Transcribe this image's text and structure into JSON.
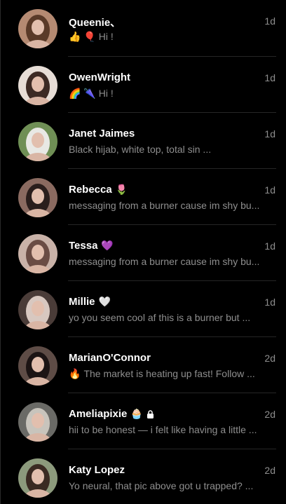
{
  "conversations": [
    {
      "name": "Queenie、",
      "name_emoji": "",
      "time": "1d",
      "preview_emoji": "👍 🎈",
      "preview": "Hi !",
      "avatar_bg": "#b58a72",
      "avatar_fg": "#5a3a28"
    },
    {
      "name": "OwenWright",
      "name_emoji": "",
      "time": "1d",
      "preview_emoji": "🌈 🌂",
      "preview": "Hi !",
      "avatar_bg": "#e6ddd6",
      "avatar_fg": "#3c2a24"
    },
    {
      "name": "Janet Jaimes",
      "name_emoji": "",
      "time": "1d",
      "preview_emoji": "",
      "preview": "Black hijab, white top, total sin ...",
      "avatar_bg": "#6f8f55",
      "avatar_fg": "#e8e8e4"
    },
    {
      "name": "Rebecca",
      "name_emoji": "🌷",
      "time": "1d",
      "preview_emoji": "",
      "preview": "messaging from a burner cause im shy bu...",
      "avatar_bg": "#8a6a60",
      "avatar_fg": "#2a1e1c"
    },
    {
      "name": "Tessa",
      "name_emoji": "💜",
      "time": "1d",
      "preview_emoji": "",
      "preview": "messaging from a burner cause im shy bu...",
      "avatar_bg": "#c9b2a8",
      "avatar_fg": "#6a4c44"
    },
    {
      "name": "Millie",
      "name_emoji": "🤍",
      "time": "1d",
      "preview_emoji": "",
      "preview": "yo you seem cool af this is a burner but ...",
      "avatar_bg": "#4a3c38",
      "avatar_fg": "#d8c8c0"
    },
    {
      "name": "MarianO'Connor",
      "name_emoji": "",
      "time": "2d",
      "preview_emoji": "🔥",
      "preview": "The market is heating up fast! Follow ...",
      "avatar_bg": "#5e4c46",
      "avatar_fg": "#1c1414"
    },
    {
      "name": "Ameliapixie",
      "name_emoji": "🧁",
      "name_lock": true,
      "time": "2d",
      "preview_emoji": "",
      "preview": "hii to be honest — i felt like having a little ...",
      "avatar_bg": "#6a6a66",
      "avatar_fg": "#c8c4bc"
    },
    {
      "name": "Katy Lopez",
      "name_emoji": "",
      "time": "2d",
      "preview_emoji": "",
      "preview": "Yo neural, that pic above got u trapped? ...",
      "avatar_bg": "#8c9a7c",
      "avatar_fg": "#3a2a22"
    }
  ],
  "colors": {
    "background": "#000000",
    "name": "#ffffff",
    "secondary": "#8e8e8e",
    "divider": "#262626"
  },
  "icons": {
    "lock": "lock-icon"
  }
}
